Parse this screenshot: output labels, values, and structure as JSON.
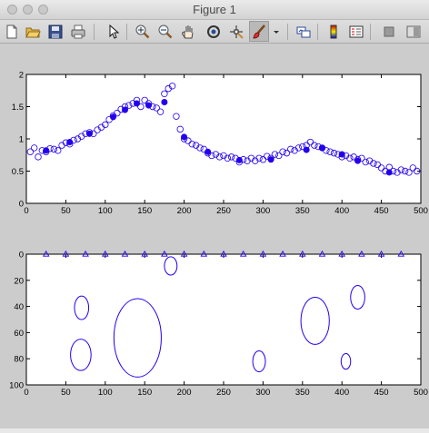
{
  "window": {
    "title": "Figure 1"
  },
  "toolbar": {
    "buttons": [
      {
        "name": "new-figure-icon"
      },
      {
        "name": "open-file-icon"
      },
      {
        "name": "save-figure-icon"
      },
      {
        "name": "print-figure-icon"
      },
      {
        "name": "edit-plot-arrow-icon"
      },
      {
        "name": "zoom-in-icon"
      },
      {
        "name": "zoom-out-icon"
      },
      {
        "name": "pan-hand-icon"
      },
      {
        "name": "rotate-3d-icon"
      },
      {
        "name": "data-cursor-icon"
      },
      {
        "name": "brush-icon",
        "pressed": true
      },
      {
        "name": "brush-menu-chevron-icon"
      },
      {
        "name": "link-plot-icon"
      },
      {
        "name": "insert-colorbar-icon"
      },
      {
        "name": "insert-legend-icon"
      },
      {
        "name": "hide-plot-tools-icon"
      },
      {
        "name": "show-plot-tools-icon"
      }
    ]
  },
  "colors": {
    "plot_blue": "#2200ee",
    "figure_background": "#cccccc",
    "axes_background": "#ffffff"
  },
  "chart_data": [
    {
      "type": "scatter",
      "title": "",
      "xlabel": "",
      "ylabel": "",
      "xlim": [
        0,
        500
      ],
      "ylim": [
        0,
        2
      ],
      "xticks": [
        "0",
        "50",
        "100",
        "150",
        "200",
        "250",
        "300",
        "350",
        "400",
        "450",
        "500"
      ],
      "yticks": [
        "0",
        "0.5",
        "1",
        "1.5",
        "2"
      ],
      "grid": false,
      "series": [
        {
          "marker": "open-circle",
          "x": [
            5,
            10,
            15,
            20,
            25,
            30,
            35,
            40,
            45,
            50,
            55,
            60,
            65,
            70,
            75,
            80,
            85,
            90,
            95,
            100,
            105,
            110,
            115,
            120,
            125,
            130,
            135,
            140,
            145,
            150,
            155,
            160,
            165,
            170,
            175,
            180,
            185,
            190,
            195,
            200,
            205,
            210,
            215,
            220,
            225,
            230,
            235,
            240,
            245,
            250,
            255,
            260,
            265,
            270,
            275,
            280,
            285,
            290,
            295,
            300,
            305,
            310,
            315,
            320,
            325,
            330,
            335,
            340,
            345,
            350,
            355,
            360,
            365,
            370,
            375,
            380,
            385,
            390,
            395,
            400,
            405,
            410,
            415,
            420,
            425,
            430,
            435,
            440,
            445,
            450,
            455,
            460,
            465,
            470,
            475,
            480,
            485,
            490,
            495
          ],
          "values": [
            0.8,
            0.86,
            0.72,
            0.82,
            0.8,
            0.85,
            0.84,
            0.82,
            0.9,
            0.94,
            0.92,
            0.98,
            1.0,
            1.04,
            1.08,
            1.1,
            1.08,
            1.14,
            1.18,
            1.22,
            1.3,
            1.36,
            1.4,
            1.46,
            1.5,
            1.52,
            1.55,
            1.6,
            1.5,
            1.6,
            1.55,
            1.5,
            1.48,
            1.42,
            1.7,
            1.78,
            1.82,
            1.35,
            1.15,
            1.0,
            0.97,
            0.92,
            0.9,
            0.86,
            0.84,
            0.78,
            0.74,
            0.76,
            0.72,
            0.74,
            0.7,
            0.72,
            0.7,
            0.64,
            0.68,
            0.66,
            0.7,
            0.66,
            0.7,
            0.68,
            0.73,
            0.7,
            0.76,
            0.74,
            0.8,
            0.78,
            0.84,
            0.82,
            0.86,
            0.88,
            0.9,
            0.95,
            0.9,
            0.88,
            0.86,
            0.82,
            0.8,
            0.78,
            0.76,
            0.72,
            0.74,
            0.7,
            0.72,
            0.68,
            0.7,
            0.64,
            0.66,
            0.62,
            0.6,
            0.55,
            0.5,
            0.56,
            0.5,
            0.48,
            0.52,
            0.5,
            0.48,
            0.55,
            0.5
          ]
        },
        {
          "marker": "filled-circle",
          "x": [
            25,
            55,
            80,
            110,
            125,
            140,
            155,
            175,
            200,
            230,
            270,
            310,
            355,
            375,
            400,
            420,
            460
          ],
          "values": [
            0.82,
            0.95,
            1.08,
            1.34,
            1.45,
            1.55,
            1.52,
            1.57,
            1.03,
            0.8,
            0.67,
            0.68,
            0.83,
            0.86,
            0.76,
            0.66,
            0.48
          ]
        }
      ]
    },
    {
      "type": "scatter",
      "title": "",
      "xlabel": "",
      "ylabel": "",
      "xlim": [
        0,
        500
      ],
      "ylim": [
        100,
        0
      ],
      "y_reversed": true,
      "xticks": [
        "0",
        "50",
        "100",
        "150",
        "200",
        "250",
        "300",
        "350",
        "400",
        "450",
        "500"
      ],
      "yticks": [
        "0",
        "20",
        "40",
        "60",
        "80",
        "100"
      ],
      "grid": false,
      "series": [
        {
          "marker": "open-triangle",
          "x": [
            25,
            50,
            75,
            100,
            125,
            150,
            175,
            200,
            225,
            250,
            275,
            300,
            325,
            350,
            375,
            400,
            425,
            450,
            475
          ],
          "values": [
            0,
            0,
            0,
            0,
            0,
            0,
            0,
            0,
            0,
            0,
            0,
            0,
            0,
            0,
            0,
            0,
            0,
            0,
            0
          ]
        }
      ],
      "ellipses": [
        {
          "cx": 70,
          "cy": 41,
          "rx": 9,
          "ry": 9
        },
        {
          "cx": 69,
          "cy": 77,
          "rx": 13,
          "ry": 12
        },
        {
          "cx": 141,
          "cy": 64,
          "rx": 30,
          "ry": 30
        },
        {
          "cx": 183,
          "cy": 9,
          "rx": 8,
          "ry": 7
        },
        {
          "cx": 295,
          "cy": 82,
          "rx": 8,
          "ry": 8
        },
        {
          "cx": 366,
          "cy": 51,
          "rx": 18,
          "ry": 18
        },
        {
          "cx": 405,
          "cy": 82,
          "rx": 6,
          "ry": 6
        },
        {
          "cx": 420,
          "cy": 33,
          "rx": 9,
          "ry": 9
        }
      ]
    }
  ]
}
